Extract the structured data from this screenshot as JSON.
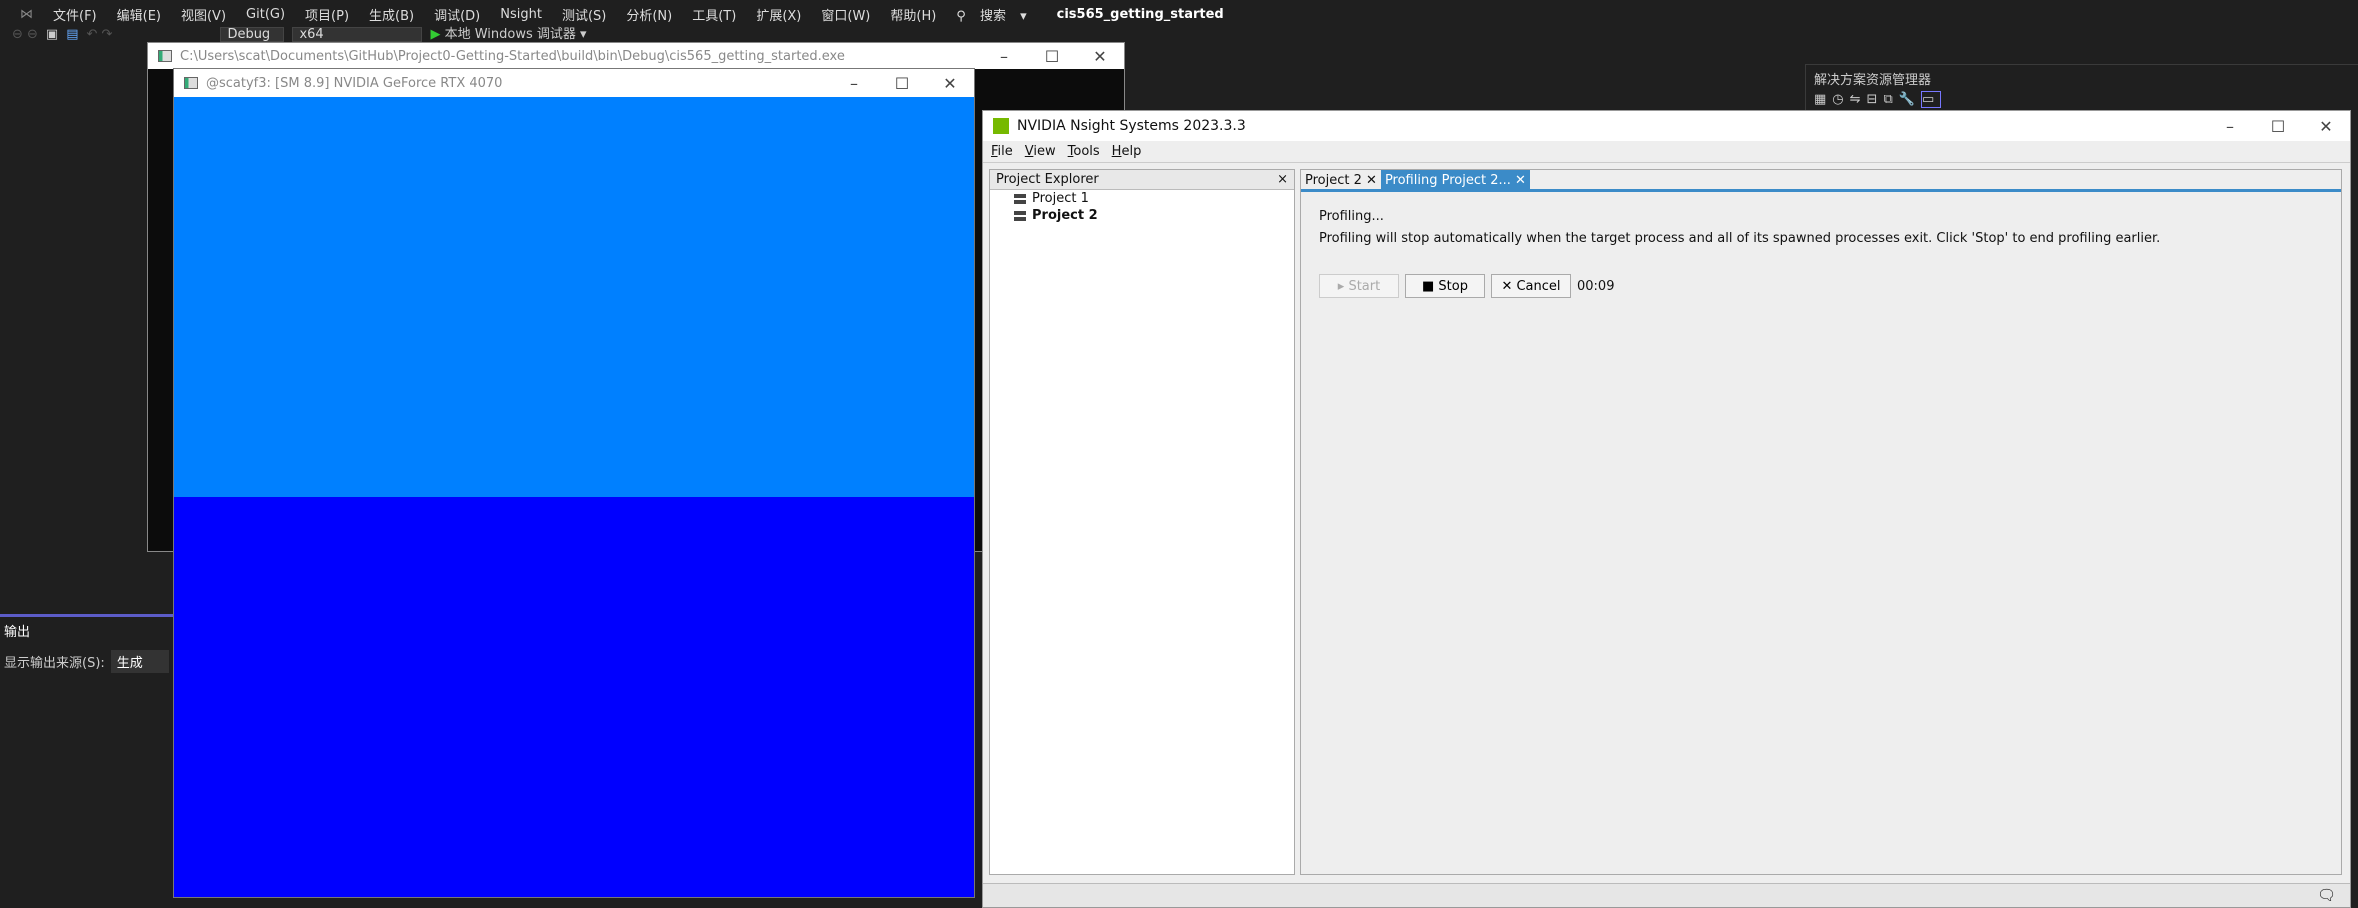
{
  "vs": {
    "menu": [
      "文件(F)",
      "编辑(E)",
      "视图(V)",
      "Git(G)",
      "项目(P)",
      "生成(B)",
      "调试(D)",
      "Nsight",
      "测试(S)",
      "分析(N)",
      "工具(T)",
      "扩展(X)",
      "窗口(W)",
      "帮助(H)"
    ],
    "search": "搜索",
    "solution_title": "cis565_getting_started",
    "config": "Debug",
    "platform": "x64",
    "run_label": "本地 Windows 调试器",
    "solution_explorer": "解决方案资源管理器",
    "output_title": "输出",
    "output_source_label": "显示输出来源(S):",
    "output_source_value": "生成"
  },
  "console": {
    "title": "C:\\Users\\scat\\Documents\\GitHub\\Project0-Getting-Started\\build\\bin\\Debug\\cis565_getting_started.exe"
  },
  "glfw": {
    "title": "@scatyf3: [SM 8.9] NVIDIA GeForce RTX 4070",
    "colors": {
      "top": "#0080ff",
      "bottom": "#0000ff"
    }
  },
  "nsight": {
    "title": "NVIDIA Nsight Systems 2023.3.3",
    "menu": [
      "File",
      "View",
      "Tools",
      "Help"
    ],
    "explorer": {
      "title": "Project Explorer",
      "close": "×",
      "projects": [
        "Project 1",
        "Project 2"
      ]
    },
    "tabs": [
      {
        "label": "Project 2"
      },
      {
        "label": "Profiling Project 2..."
      }
    ],
    "status": "Profiling...",
    "message": "Profiling will stop automatically when the target process and all of its spawned processes exit. Click 'Stop' to end profiling earlier.",
    "buttons": {
      "start": "▸ Start",
      "stop": "■ Stop",
      "cancel": "✕ Cancel"
    },
    "elapsed": "00:09",
    "accent": "#3b8bc8"
  }
}
